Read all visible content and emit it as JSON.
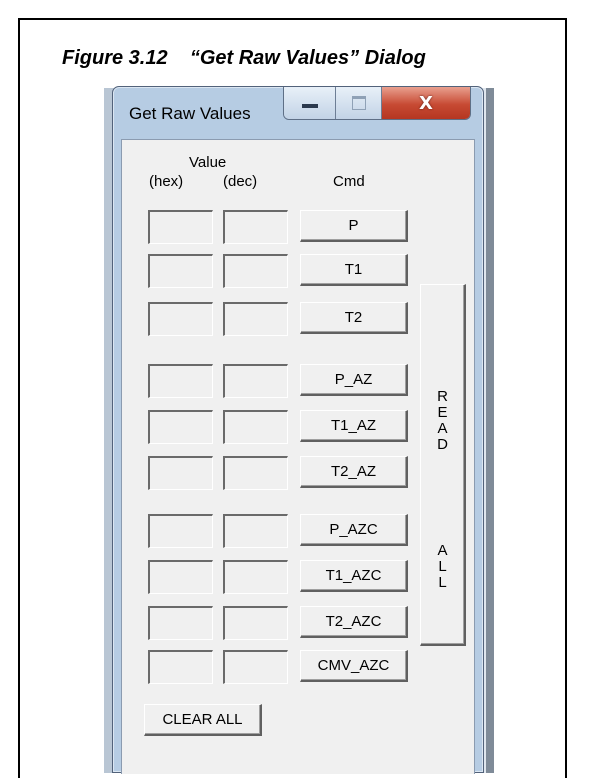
{
  "caption": "Figure 3.12    “Get Raw Values” Dialog",
  "dialog": {
    "title": "Get Raw Values",
    "window_buttons": {
      "minimize": "minimize-icon",
      "maximize": "maximize-icon",
      "close": "X"
    },
    "headers": {
      "value": "Value",
      "hex": "(hex)",
      "dec": "(dec)",
      "cmd": "Cmd"
    },
    "rows": [
      {
        "hex": "",
        "dec": "",
        "cmd": "P"
      },
      {
        "hex": "",
        "dec": "",
        "cmd": "T1"
      },
      {
        "hex": "",
        "dec": "",
        "cmd": "T2"
      },
      {
        "hex": "",
        "dec": "",
        "cmd": "P_AZ"
      },
      {
        "hex": "",
        "dec": "",
        "cmd": "T1_AZ"
      },
      {
        "hex": "",
        "dec": "",
        "cmd": "T2_AZ"
      },
      {
        "hex": "",
        "dec": "",
        "cmd": "P_AZC"
      },
      {
        "hex": "",
        "dec": "",
        "cmd": "T1_AZC"
      },
      {
        "hex": "",
        "dec": "",
        "cmd": "T2_AZC"
      },
      {
        "hex": "",
        "dec": "",
        "cmd": "CMV_AZC"
      }
    ],
    "read_all": {
      "read": "R\nE\nA\nD",
      "all": "A\nL\nL"
    },
    "clear_all": "CLEAR ALL"
  }
}
